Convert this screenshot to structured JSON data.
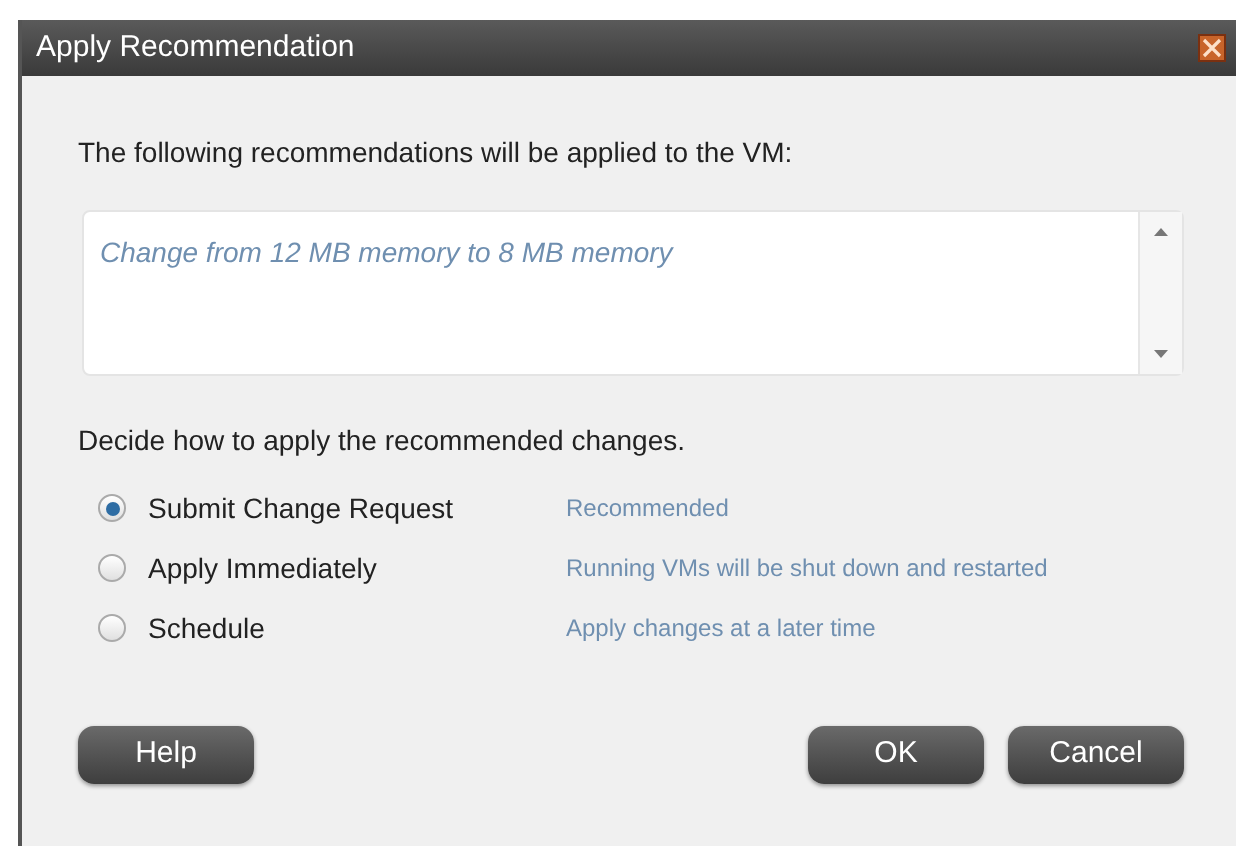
{
  "window": {
    "title": "Apply Recommendation"
  },
  "intro": "The following recommendations will be applied to the VM:",
  "recommendations": [
    "Change from 12 MB memory to 8 MB memory"
  ],
  "prompt": "Decide how to apply the recommended changes.",
  "options": [
    {
      "label": "Submit Change Request",
      "note": "Recommended",
      "selected": true
    },
    {
      "label": "Apply Immediately",
      "note": "Running VMs will be shut down and restarted",
      "selected": false
    },
    {
      "label": "Schedule",
      "note": "Apply changes at a later time",
      "selected": false
    }
  ],
  "buttons": {
    "left": [
      "Help"
    ],
    "right": [
      "OK",
      "Cancel"
    ]
  }
}
